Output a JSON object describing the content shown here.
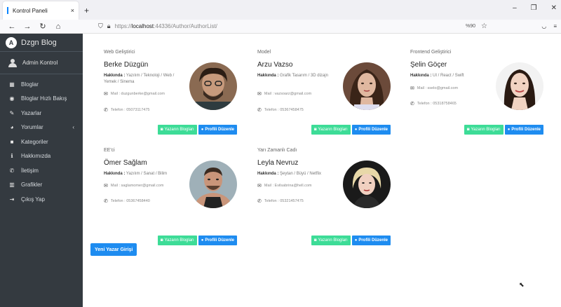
{
  "browser": {
    "tab_title": "Kontrol Paneli",
    "tab_close": "×",
    "new_tab": "+",
    "url_prefix": "https://",
    "url_host": "localhost",
    "url_rest": ":44336/Author/AuthorList/",
    "zoom": "%90",
    "win_minimize": "–",
    "win_restore": "❐",
    "win_close": "✕"
  },
  "sidebar": {
    "brand": "Dzgn Blog",
    "brand_logo": "A",
    "user": "Admin Kontrol",
    "items": [
      {
        "label": "Bloglar",
        "icon": "▦"
      },
      {
        "label": "Bloglar Hızlı Bakış",
        "icon": "◉"
      },
      {
        "label": "Yazarlar",
        "icon": "✎"
      },
      {
        "label": "Yorumlar",
        "icon": "◕",
        "arrow": "‹"
      },
      {
        "label": "Kategoriler",
        "icon": "■"
      },
      {
        "label": "Hakkımızda",
        "icon": "ℹ"
      },
      {
        "label": "İletişim",
        "icon": "✆"
      },
      {
        "label": "Grafikler",
        "icon": "▥"
      },
      {
        "label": "Çıkış Yap",
        "icon": "⇥"
      }
    ]
  },
  "labels": {
    "about": "Hakkında :",
    "mail": "Mail :",
    "phone": "Telefon :",
    "btn_blogs": "Yazarın Blogları",
    "btn_edit": "Profili Düzenle",
    "new_author": "Yeni Yazar Girişi"
  },
  "authors": [
    {
      "role": "Web Geliştirici",
      "name": "Berke Düzgün",
      "about": "Yazılım / Teknoloji / Web / Yemek / Sinema",
      "mail": "duzgunberke@gmail.com",
      "phone": "05073117475"
    },
    {
      "role": "Model",
      "name": "Arzu Vazso",
      "about": "Grafik Tasarım / 3D dizajn",
      "mail": "vazsoarz@gmail.com",
      "phone": "05367458475"
    },
    {
      "role": "Frontend Geliştirici",
      "name": "Şelin Göçer",
      "about": "UI / React / Swift",
      "mail": "sselo@gmail.com",
      "phone": "05318758465"
    },
    {
      "role": "EE'ci",
      "name": "Ömer Sağlam",
      "about": "Yazılım / Sanat / Bilim",
      "mail": "saglamomer@gmail.com",
      "phone": "05367458440"
    },
    {
      "role": "Yarı Zamanlı Cadı",
      "name": "Leyla Nevruz",
      "about": "Şeytan / Büyü / Netflix",
      "mail": "Evilsabrina@hell.com",
      "phone": "05321457475"
    }
  ]
}
